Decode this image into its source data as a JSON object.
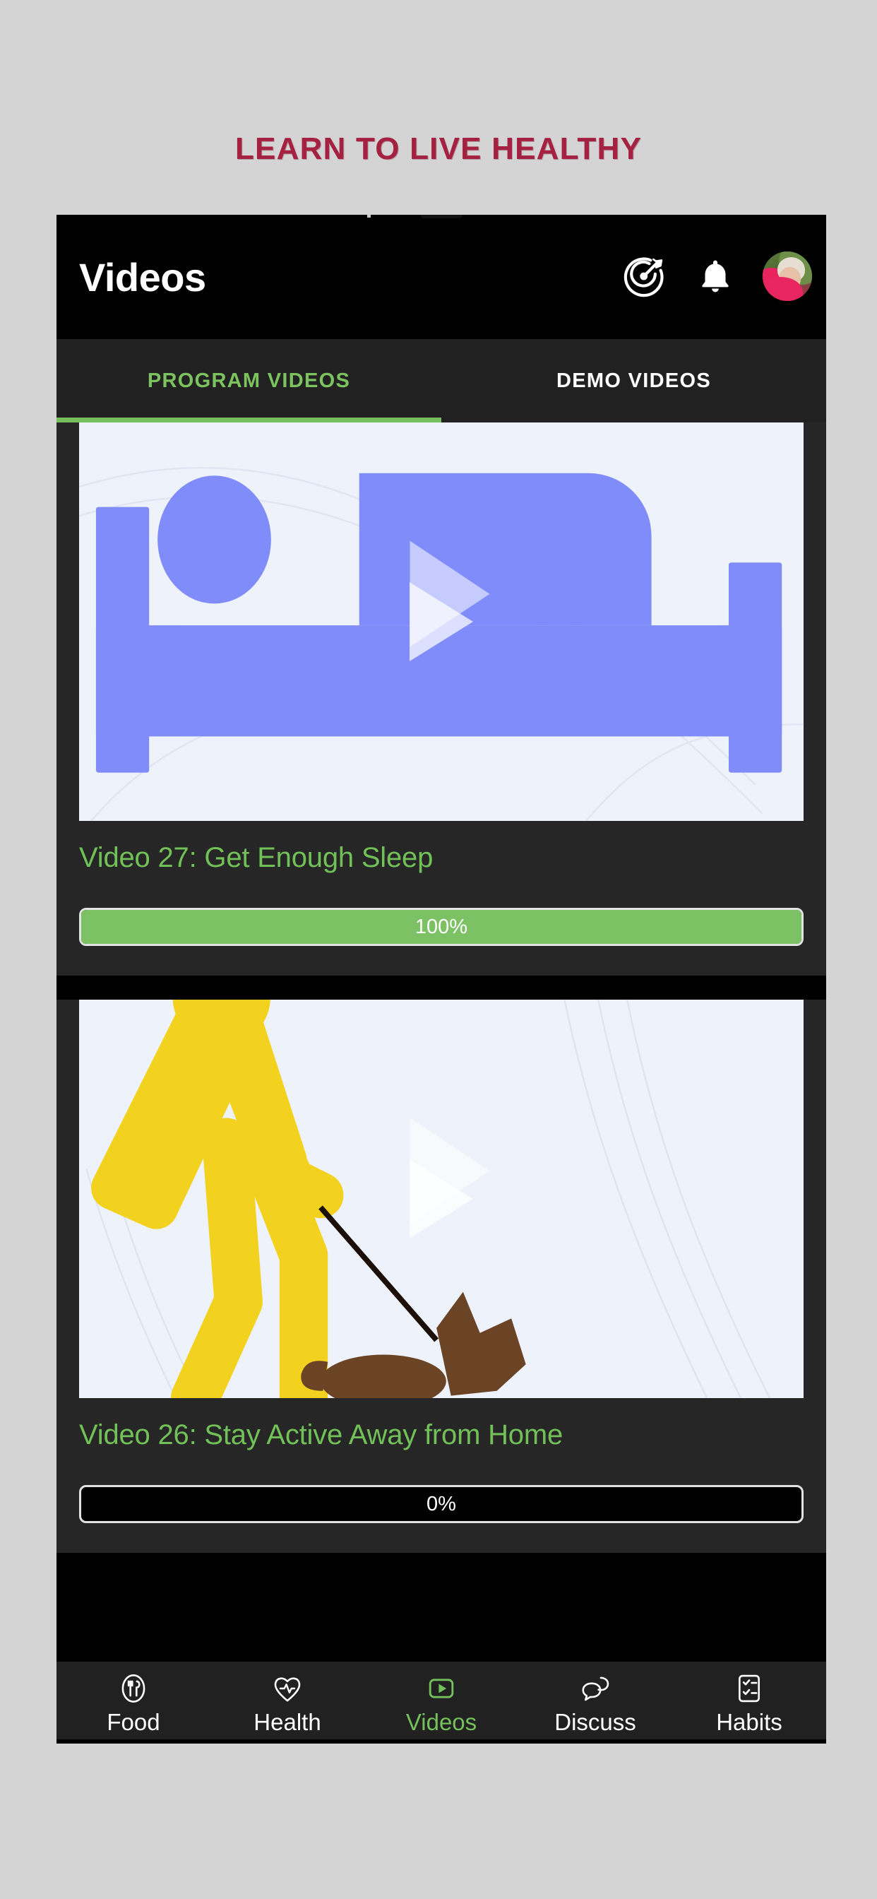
{
  "page": {
    "heading": "LEARN TO LIVE HEALTHY",
    "heading_color": "#a52142",
    "background_color": "#d4d4d4"
  },
  "appbar": {
    "title": "Videos",
    "background_color": "#000000",
    "actions": [
      {
        "name": "goals-target-icon",
        "label": "Goals"
      },
      {
        "name": "bell-icon",
        "label": "Notifications"
      },
      {
        "name": "avatar",
        "label": "Profile"
      }
    ]
  },
  "tabs": {
    "items": [
      {
        "label": "PROGRAM VIDEOS",
        "active": true
      },
      {
        "label": "DEMO VIDEOS",
        "active": false
      }
    ],
    "active_color": "#7cc25f",
    "inactive_color": "#ffffff",
    "indicator_color": "#76bf5e"
  },
  "videos": [
    {
      "title": "Video 27: Get Enough Sleep",
      "progress_label": "100%",
      "progress_value": 100,
      "thumbnail": "sleeping-in-bed-illustration",
      "thumbnail_colors": {
        "background": "#eef2fa",
        "figure": "#808cfa"
      }
    },
    {
      "title": "Video 26: Stay Active Away from Home",
      "progress_label": "0%",
      "progress_value": 0,
      "thumbnail": "person-walking-dog-illustration",
      "thumbnail_colors": {
        "background": "#eef2fa",
        "figure": "#f2d21e",
        "dog": "#6b4425"
      }
    }
  ],
  "bottom_nav": {
    "items": [
      {
        "label": "Food",
        "icon": "plate-utensils-icon",
        "active": false
      },
      {
        "label": "Health",
        "icon": "heart-pulse-icon",
        "active": false
      },
      {
        "label": "Videos",
        "icon": "play-rect-icon",
        "active": true
      },
      {
        "label": "Discuss",
        "icon": "speech-bubbles-icon",
        "active": false
      },
      {
        "label": "Habits",
        "icon": "checklist-icon",
        "active": false
      }
    ],
    "active_color": "#74c05a",
    "inactive_color": "#ffffff"
  }
}
